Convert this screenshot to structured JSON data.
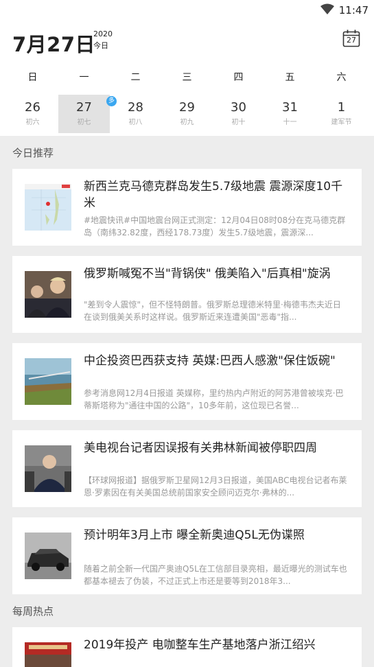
{
  "status_bar": {
    "time": "11:47"
  },
  "header": {
    "date": "7月27日",
    "year": "2020",
    "today_label": "今日",
    "calendar_icon_day": "27"
  },
  "week": {
    "weekdays": [
      "日",
      "一",
      "二",
      "三",
      "四",
      "五",
      "六"
    ],
    "days": [
      {
        "day": "26",
        "lunar": "初六"
      },
      {
        "day": "27",
        "lunar": "初七",
        "selected": true,
        "badge": "多"
      },
      {
        "day": "28",
        "lunar": "初八"
      },
      {
        "day": "29",
        "lunar": "初九"
      },
      {
        "day": "30",
        "lunar": "初十"
      },
      {
        "day": "31",
        "lunar": "十一"
      },
      {
        "day": "1",
        "lunar": "建军节"
      }
    ]
  },
  "sections": {
    "today_title": "今日推荐",
    "weekly_title": "每周热点"
  },
  "news": [
    {
      "title": "新西兰克马德克群岛发生5.7级地震 震源深度10千米",
      "desc": "#地震快讯#中国地震台网正式测定：12月04日08时08分在克马德克群岛（南纬32.82度，西经178.73度）发生5.7级地震，震源深..."
    },
    {
      "title": "俄罗斯喊冤不当\"背锅侠\" 俄美陷入\"后真相\"旋涡",
      "desc": "\"差到令人震惊\"，但不怪特朗普。俄罗斯总理德米特里·梅德韦杰夫近日在谈到俄美关系时这样说。俄罗斯近来连遭美国\"恶毒\"指..."
    },
    {
      "title": "中企投资巴西获支持 英媒:巴西人感激\"保住饭碗\"",
      "desc": "参考消息网12月4日报道 英媒称，里约热内卢附近的阿苏港曾被埃克·巴蒂斯塔称为\"通往中国的公路\"，10多年前，这位现已名誉..."
    },
    {
      "title": "美电视台记者因误报有关弗林新闻被停职四周",
      "desc": "【环球网报道】据俄罗斯卫星网12月3日报道，美国ABC电视台记者布莱恩·罗素因在有关美国总统前国家安全顾问迈克尔·弗林的..."
    },
    {
      "title": "预计明年3月上市 曝全新奥迪Q5L无伪谍照",
      "desc": "随着之前全新一代国产奥迪Q5L在工信部目录亮相，最近曝光的测试车也都基本褪去了伪装，不过正式上市还是要等到2018年3..."
    }
  ],
  "weekly": [
    {
      "title": "2019年投产 电咖整车生产基地落户浙江绍兴"
    }
  ]
}
